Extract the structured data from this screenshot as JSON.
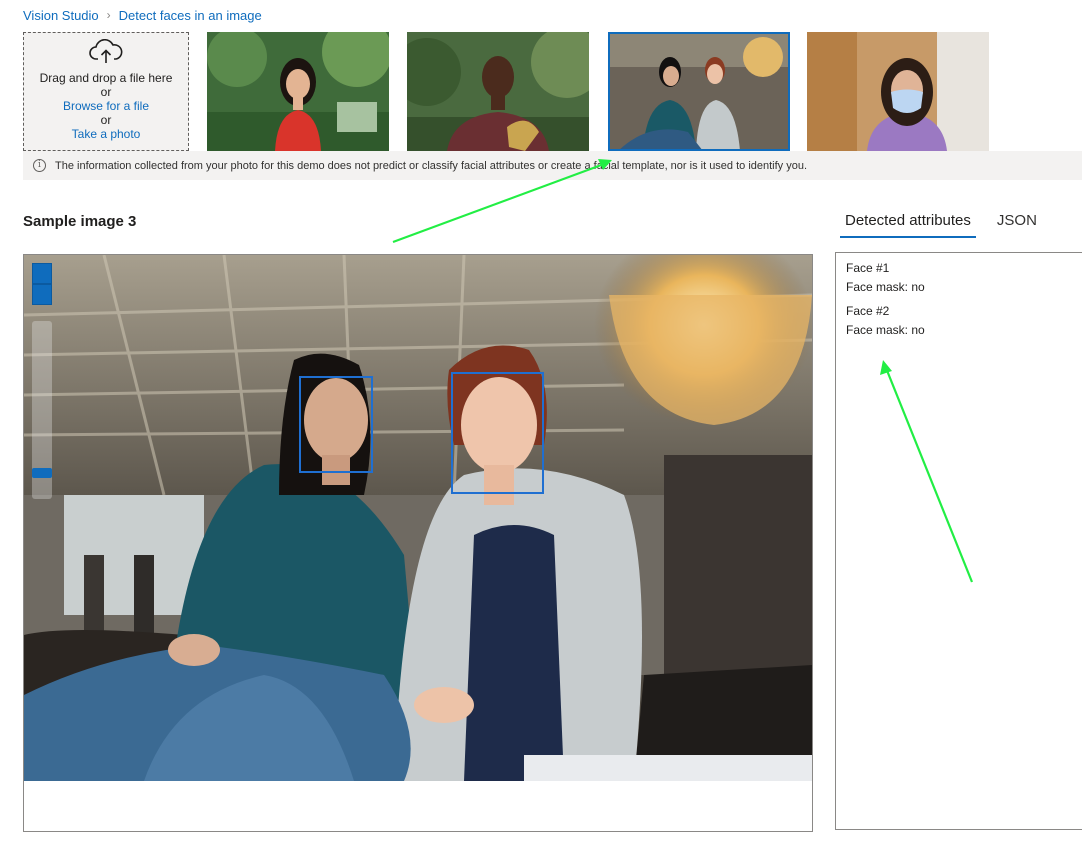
{
  "breadcrumb": {
    "root": "Vision Studio",
    "current": "Detect faces in an image"
  },
  "upload": {
    "drag_text": "Drag and drop a file here",
    "or1": "or",
    "browse": "Browse for a file",
    "or2": "or",
    "take_photo": "Take a photo",
    "icon": "cloud-upload-icon"
  },
  "info": {
    "icon": "info-icon",
    "text": "The information collected from your photo for this demo does not predict or classify facial attributes or create a facial template, nor is it used to identify you."
  },
  "sample": {
    "title": "Sample image 3"
  },
  "tabs": [
    {
      "label": "Detected attributes",
      "active": true
    },
    {
      "label": "JSON",
      "active": false
    }
  ],
  "detected": [
    {
      "face": "Face #1",
      "mask": "Face mask: no"
    },
    {
      "face": "Face #2",
      "mask": "Face mask: no"
    }
  ],
  "colors": {
    "accent": "#0f6cbd",
    "annotation_arrow": "#22ee44",
    "face_box": "#1f6fd1"
  }
}
